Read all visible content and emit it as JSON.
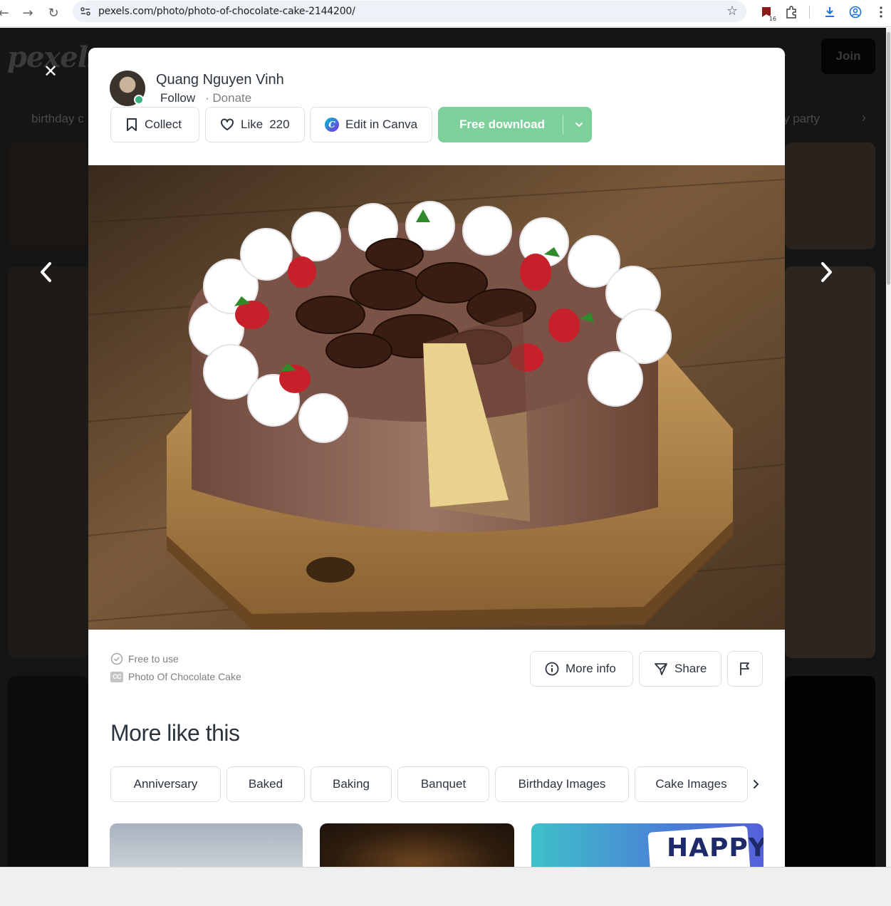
{
  "browser": {
    "url": "pexels.com/photo/photo-of-chocolate-cake-2144200/",
    "extension_badge": "16"
  },
  "background": {
    "logo": "pexels",
    "join_label": "Join",
    "more_dots": "·",
    "tag_left": "birthday c",
    "tag_right": "y party"
  },
  "author": {
    "name": "Quang Nguyen Vinh",
    "follow_label": "Follow",
    "donate_label": "· Donate"
  },
  "actions": {
    "collect_label": "Collect",
    "like_label": "Like",
    "like_count": "220",
    "canva_label": "Edit in Canva",
    "canva_logo": "C",
    "download_label": "Free download"
  },
  "photo_info": {
    "license_label": "Free to use",
    "title": "Photo Of Chocolate Cake",
    "cc_icon_text": "CC"
  },
  "info_actions": {
    "more_info_label": "More info",
    "share_label": "Share"
  },
  "related": {
    "heading": "More like this",
    "tags": [
      "Anniversary",
      "Baked",
      "Baking",
      "Banquet",
      "Birthday Images",
      "Cake Images"
    ],
    "thumb3_text": "HAPPY"
  },
  "colors": {
    "download_green": "#7ed09a",
    "text_primary": "#2c343e",
    "text_muted": "#7f7f7f"
  },
  "icons": [
    "back-icon",
    "forward-icon",
    "reload-icon",
    "site-info-icon",
    "star-icon",
    "extension-icon",
    "puzzle-icon",
    "download-icon",
    "profile-icon",
    "menu-icon",
    "close-icon",
    "chevron-left-icon",
    "chevron-right-icon",
    "bookmark-icon",
    "heart-icon",
    "canva-icon",
    "chevron-down-icon",
    "check-circle-icon",
    "cc-icon",
    "info-icon",
    "share-icon",
    "flag-icon"
  ]
}
